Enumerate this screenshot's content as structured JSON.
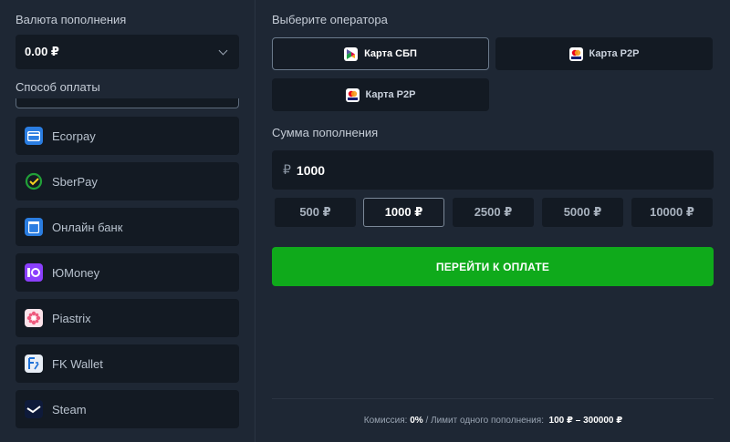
{
  "left": {
    "currency_label": "Валюта пополнения",
    "currency_value": "0.00 ₽",
    "payment_label": "Способ оплаты",
    "methods": [
      {
        "label": "Ecorpay",
        "icon": "card-icon",
        "color": "#2a7de1"
      },
      {
        "label": "SberPay",
        "icon": "sberpay-icon",
        "color": "#21a038"
      },
      {
        "label": "Онлайн банк",
        "icon": "bank-icon",
        "color": "#2a7de1"
      },
      {
        "label": "ЮMoney",
        "icon": "yoomoney-icon",
        "color": "#8b3ffd"
      },
      {
        "label": "Piastrix",
        "icon": "piastrix-icon",
        "color": "#f4a3b5"
      },
      {
        "label": "FK Wallet",
        "icon": "fkwallet-icon",
        "color": "#e8eef6"
      },
      {
        "label": "Steam",
        "icon": "steam-icon",
        "color": "#0e1a3a"
      }
    ]
  },
  "right": {
    "operator_label": "Выберите оператора",
    "operators": [
      {
        "label": "Карта СБП",
        "icon": "sbp-icon",
        "active": true
      },
      {
        "label": "Карта P2P",
        "icon": "mastercard-visa-icon",
        "active": false
      },
      {
        "label": "Карта P2P",
        "icon": "mastercard-visa-icon",
        "active": false
      }
    ],
    "amount_label": "Сумма пополнения",
    "amount_currency": "₽",
    "amount_value": "1000",
    "presets": [
      "500 ₽",
      "1000 ₽",
      "2500 ₽",
      "5000 ₽",
      "10000 ₽"
    ],
    "active_preset": "1000 ₽",
    "pay_button": "ПЕРЕЙТИ К ОПЛАТЕ",
    "footer": {
      "commission_label": "Комиссия:",
      "commission_value": "0%",
      "separator": "/",
      "limit_label": "Лимит одного пополнения:",
      "limit_value": "100 ₽ – 300000 ₽"
    }
  },
  "colors": {
    "background": "#1e2734",
    "panel": "#131a23",
    "accent_green": "#0faa1b"
  }
}
